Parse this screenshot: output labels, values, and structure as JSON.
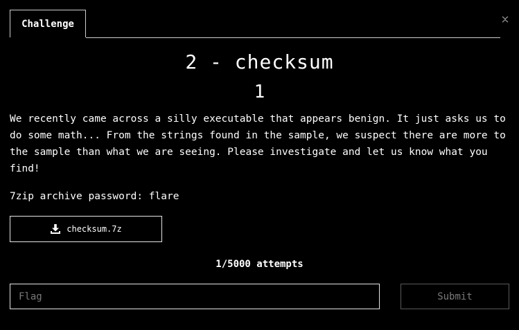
{
  "tabs": [
    {
      "label": "Challenge"
    }
  ],
  "challenge": {
    "title": "2 - checksum",
    "points": "1",
    "description": "We recently came across a silly executable that appears benign. It just asks us to do some math... From the strings found in the sample, we suspect there are more to the sample than what we are seeing. Please investigate and let us know what you find!",
    "password_line": "7zip archive password: flare",
    "file": {
      "name": "checksum.7z",
      "icon": "download-icon"
    },
    "attempts": "1/5000 attempts"
  },
  "form": {
    "flag_placeholder": "Flag",
    "flag_value": "",
    "submit_label": "Submit"
  },
  "icons": {
    "close": "close-icon"
  },
  "colors": {
    "background": "#000000",
    "text": "#ffffff",
    "border": "#e6e6e6",
    "muted": "#7a7a7a"
  }
}
